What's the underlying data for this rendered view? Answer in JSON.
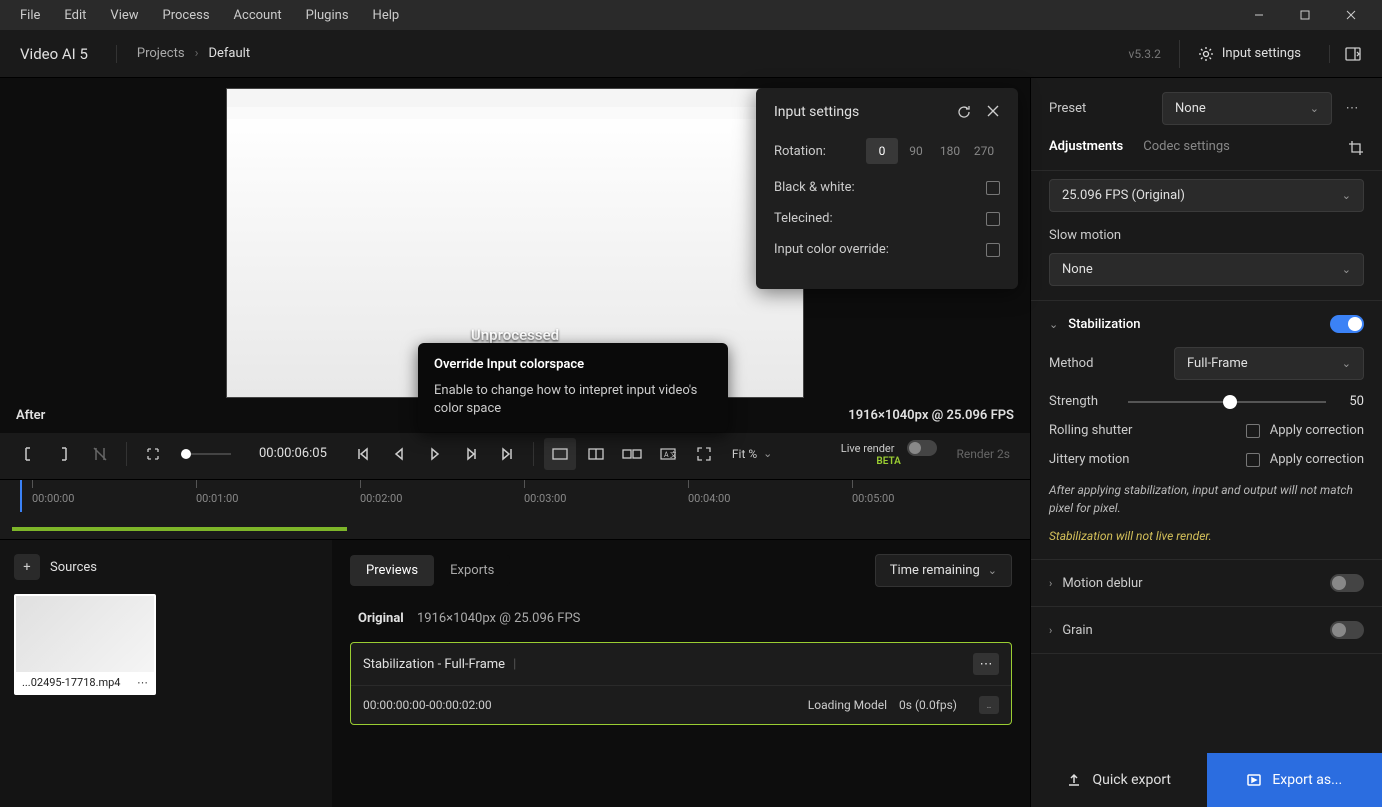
{
  "menubar": {
    "items": [
      "File",
      "Edit",
      "View",
      "Process",
      "Account",
      "Plugins",
      "Help"
    ]
  },
  "header": {
    "app_title": "Video AI  5",
    "breadcrumb": [
      "Projects",
      "Default"
    ],
    "version": "v5.3.2",
    "input_settings_label": "Input settings"
  },
  "preview": {
    "unprocessed": "Unprocessed",
    "after_label": "After",
    "resolution": "1916×1040px @ 25.096 FPS"
  },
  "tooltip": {
    "title": "Override Input colorspace",
    "desc": "Enable to change how to intepret input video's color space"
  },
  "input_settings_popup": {
    "title": "Input settings",
    "rotation_label": "Rotation:",
    "rotation_options": [
      "0",
      "90",
      "180",
      "270"
    ],
    "rotation_active": "0",
    "bw_label": "Black & white:",
    "telecined_label": "Telecined:",
    "color_override_label": "Input color override:"
  },
  "transport": {
    "timecode": "00:00:06:05",
    "fit_label": "Fit %",
    "live_render": "Live render",
    "beta": "BETA",
    "render_btn": "Render 2s"
  },
  "timeline": {
    "ticks": [
      "00:00:00",
      "00:01:00",
      "00:02:00",
      "00:03:00",
      "00:04:00",
      "00:05:00"
    ]
  },
  "sources": {
    "title": "Sources",
    "thumb_name": "...02495-17718.mp4"
  },
  "previews": {
    "tab_previews": "Previews",
    "tab_exports": "Exports",
    "time_remaining": "Time remaining",
    "original_label": "Original",
    "original_info": "1916×1040px @ 25.096 FPS",
    "job_title": "Stabilization  -  Full-Frame",
    "job_range": "00:00:00:00-00:00:02:00",
    "job_status": "Loading Model",
    "job_time": "0s  (0.0fps)"
  },
  "right": {
    "preset_label": "Preset",
    "preset_value": "None",
    "tab_adjustments": "Adjustments",
    "tab_codec": "Codec settings",
    "fps_value": "25.096 FPS (Original)",
    "slowmo_label": "Slow motion",
    "slowmo_value": "None",
    "stab_label": "Stabilization",
    "method_label": "Method",
    "method_value": "Full-Frame",
    "strength_label": "Strength",
    "strength_value": "50",
    "rolling_label": "Rolling shutter",
    "apply_correction": "Apply correction",
    "jittery_label": "Jittery motion",
    "note1": "After applying stabilization, input and output will not match pixel for pixel.",
    "note2": "Stabilization will not live render.",
    "motion_deblur": "Motion deblur",
    "grain": "Grain",
    "quick_export": "Quick export",
    "export_as": "Export as..."
  }
}
